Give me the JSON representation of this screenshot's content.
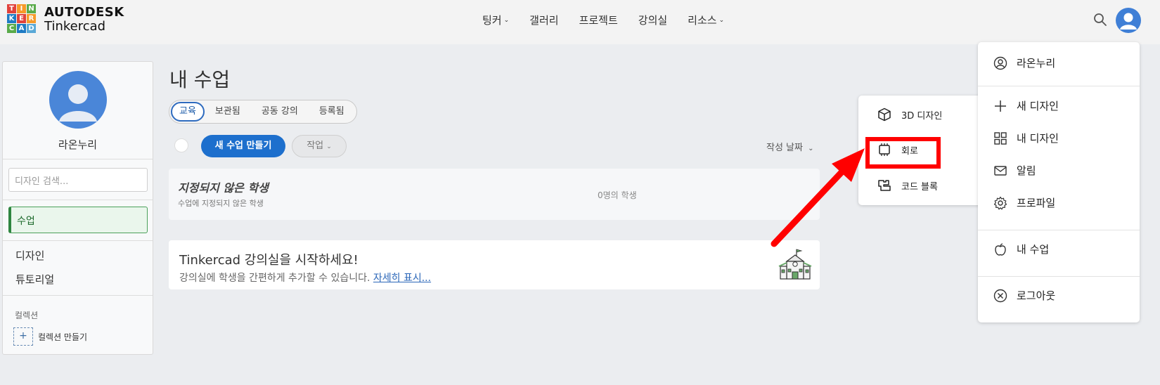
{
  "header": {
    "logo_letters": [
      "T",
      "I",
      "N",
      "K",
      "E",
      "R",
      "C",
      "A",
      "D"
    ],
    "logo_colors": [
      "#e2423c",
      "#f79a29",
      "#5aab4a",
      "#1f7bc4",
      "#e2423c",
      "#f79a29",
      "#5aab4a",
      "#1f7bc4",
      "#5aa9d7"
    ],
    "brand_line1": "AUTODESK",
    "brand_line2": "Tinkercad",
    "nav": [
      {
        "label": "팅커",
        "has_dropdown": true
      },
      {
        "label": "갤러리",
        "has_dropdown": false
      },
      {
        "label": "프로젝트",
        "has_dropdown": false
      },
      {
        "label": "강의실",
        "has_dropdown": false
      },
      {
        "label": "리소스",
        "has_dropdown": true
      }
    ],
    "search_icon": "search-icon",
    "avatar_icon": "user-avatar-icon"
  },
  "sidebar": {
    "username": "라온누리",
    "search_placeholder": "디자인 검색...",
    "active_item": "수업",
    "items": [
      "디자인",
      "튜토리얼"
    ],
    "collection_label": "컬렉션",
    "create_collection": "컬렉션 만들기"
  },
  "main": {
    "title": "내 수업",
    "tabs": [
      {
        "label": "교육",
        "active": true
      },
      {
        "label": "보관됨",
        "active": false
      },
      {
        "label": "공동 강의",
        "active": false
      },
      {
        "label": "등록됨",
        "active": false
      }
    ],
    "new_class_button": "새 수업 만들기",
    "task_button": "작업",
    "sort_label": "작성 날짜",
    "unassigned": {
      "title": "지정되지 않은 학생",
      "subtitle": "수업에 지정되지 않은 학생",
      "count": "0명의 학생"
    },
    "promo": {
      "title": "Tinkercad 강의실을 시작하세요!",
      "subtitle": "강의실에 학생을 간편하게 추가할 수 있습니다. ",
      "link": "자세히 표시..."
    }
  },
  "create_menu": {
    "items": [
      {
        "label": "3D 디자인",
        "icon": "cube-icon"
      },
      {
        "label": "회로",
        "icon": "circuit-chip-icon",
        "highlighted": true
      },
      {
        "label": "코드 블록",
        "icon": "code-blocks-icon"
      }
    ]
  },
  "user_menu": {
    "username": "라온누리",
    "items": [
      {
        "label": "새 디자인",
        "icon": "plus-icon"
      },
      {
        "label": "내 디자인",
        "icon": "grid-icon"
      },
      {
        "label": "알림",
        "icon": "mail-icon"
      },
      {
        "label": "프로파일",
        "icon": "gear-icon"
      }
    ],
    "my_classes": "내 수업",
    "logout": "로그아웃"
  },
  "annotation": {
    "color": "#ff0000"
  }
}
